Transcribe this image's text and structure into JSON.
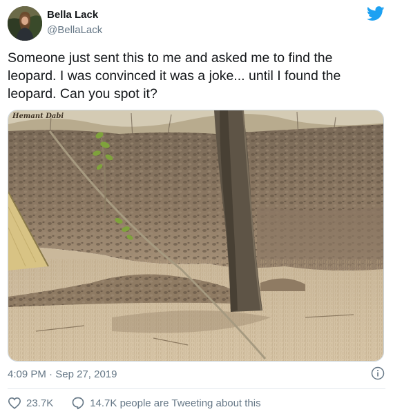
{
  "user": {
    "display_name": "Bella Lack",
    "handle": "@BellaLack",
    "avatar_icon": "profile-photo"
  },
  "brand": {
    "icon": "twitter-bird-icon",
    "color": "#1da1f2"
  },
  "tweet": {
    "text": "Someone just sent this to me and asked me to find the leopard. I was convinced it was a joke... until I found the leopard. Can you spot it?",
    "media": {
      "watermark": "Hemant Dabi",
      "description_icon": "photo"
    },
    "time": "4:09 PM",
    "separator": "·",
    "date": "Sep 27, 2019"
  },
  "actions": {
    "likes_count": "23.7K",
    "like_icon": "heart-icon",
    "reply_icon": "speech-bubble-icon",
    "tweeting_text": "14.7K people are Tweeting about this"
  },
  "colors": {
    "text_primary": "#14171a",
    "text_secondary": "#657786",
    "border": "#ccd6dd"
  }
}
